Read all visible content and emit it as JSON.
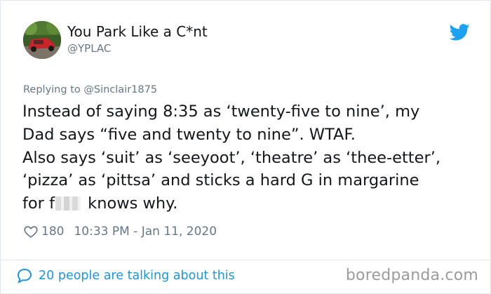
{
  "user": {
    "display_name": "You Park Like a C*nt",
    "handle": "@YPLAC"
  },
  "icons": {
    "avatar": "avatar-photo-red-car",
    "brand": "twitter-bird-icon",
    "like": "heart-outline-icon",
    "replies": "speech-bubble-icon"
  },
  "colors": {
    "twitter_blue": "#1da1f2",
    "link_blue": "#1b95e0",
    "secondary_text": "#657786",
    "primary_text": "#14171a"
  },
  "tweet": {
    "reply_prefix": "Replying to",
    "reply_to": "@Sinclair1875",
    "lines": [
      "Instead of saying 8:35 as ‘twenty-five to nine’, my",
      "Dad says “five and twenty to nine”. WTAF.",
      "Also says ‘suit’ as ‘seeyoot’, ‘theatre’ as ‘thee-etter’,",
      "‘pizza’ as ‘pittsa’ and sticks a hard G in margarine"
    ],
    "last_line_start": "for f",
    "last_line_end": " knows why."
  },
  "meta": {
    "likes": "180",
    "timestamp": "10:33 PM - Jan 11, 2020"
  },
  "footer": {
    "talking": "20 people are talking about this",
    "watermark": "boredpanda.com"
  }
}
